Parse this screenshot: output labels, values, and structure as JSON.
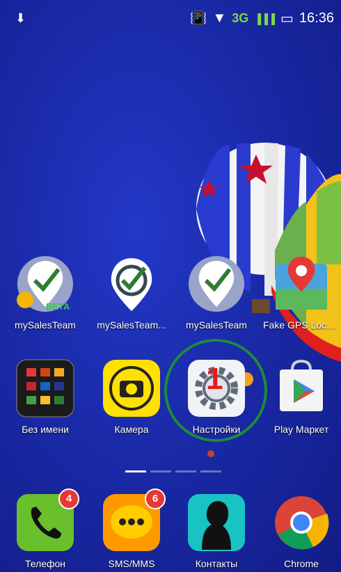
{
  "status_bar": {
    "network": "3G",
    "time": "16:36"
  },
  "apps_row1": [
    {
      "label": "mySalesTeam",
      "badge_text": "BETA"
    },
    {
      "label": "mySalesTeam..."
    },
    {
      "label": "mySalesTeam"
    },
    {
      "label": "Fake GPS Locat..."
    }
  ],
  "apps_row2": [
    {
      "label": "Без имени"
    },
    {
      "label": "Камера"
    },
    {
      "label": "Настройки"
    },
    {
      "label": "Play Маркет"
    }
  ],
  "dock": [
    {
      "label": "Телефон",
      "badge": "4"
    },
    {
      "label": "SMS/MMS",
      "badge": "6"
    },
    {
      "label": "Контакты"
    },
    {
      "label": "Chrome"
    }
  ],
  "annotation": {
    "step_number": "1",
    "color": "#e11d1d",
    "circle_color": "#1f8a3a"
  },
  "page_indicator": {
    "pages": 4,
    "active": 0
  }
}
